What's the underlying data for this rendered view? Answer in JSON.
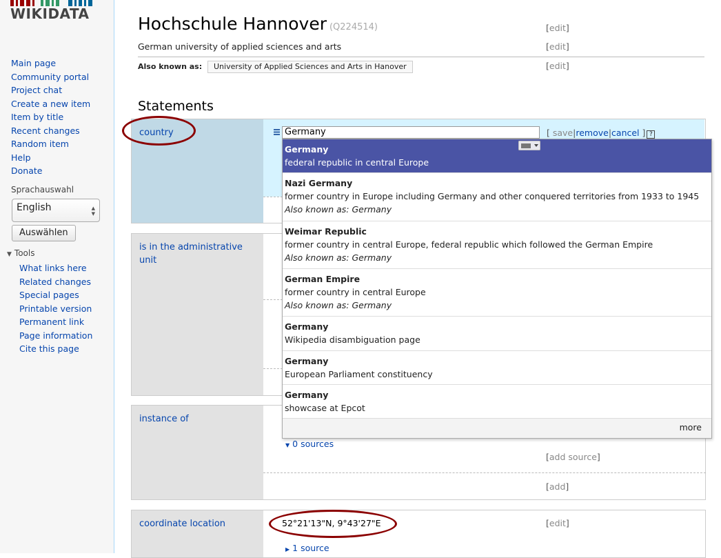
{
  "site": {
    "logo_text": "WIKIDATA"
  },
  "sidebar": {
    "nav": [
      {
        "label": "Main page"
      },
      {
        "label": "Community portal"
      },
      {
        "label": "Project chat"
      },
      {
        "label": "Create a new item"
      },
      {
        "label": "Item by title"
      },
      {
        "label": "Recent changes"
      },
      {
        "label": "Random item"
      },
      {
        "label": "Help"
      },
      {
        "label": "Donate"
      }
    ],
    "language": {
      "heading": "Sprachauswahl",
      "selected": "English",
      "button": "Auswählen"
    },
    "tools": {
      "heading": "Tools",
      "items": [
        {
          "label": "What links here"
        },
        {
          "label": "Related changes"
        },
        {
          "label": "Special pages"
        },
        {
          "label": "Printable version"
        },
        {
          "label": "Permanent link"
        },
        {
          "label": "Page information"
        },
        {
          "label": "Cite this page"
        }
      ]
    }
  },
  "item": {
    "title": "Hochschule Hannover",
    "qid": "(Q224514)",
    "description": "German university of applied sciences and arts",
    "aka_label": "Also known as:",
    "aliases": [
      "University of Applied Sciences and Arts in Hanover"
    ],
    "edit_label": "edit"
  },
  "statements": {
    "heading": "Statements",
    "groups": [
      {
        "property": "country"
      },
      {
        "property": "is in the administrative unit"
      },
      {
        "property": "instance of",
        "sources_label": "0 sources",
        "add_source_label": "add source",
        "add_label": "add"
      },
      {
        "property": "coordinate location",
        "value": "52°21'13\"N, 9°43'27\"E",
        "sources_label": "1 source",
        "edit_label": "edit"
      }
    ]
  },
  "editor": {
    "input_value": "Germany",
    "save_label": "save",
    "remove_label": "remove",
    "cancel_label": "cancel",
    "help_label": "?"
  },
  "suggestions": {
    "items": [
      {
        "label": "Germany",
        "description": "federal republic in central Europe",
        "aka": ""
      },
      {
        "label": "Nazi Germany",
        "description": "former country in Europe including Germany and other conquered territories from 1933 to 1945",
        "aka": "Also known as: Germany"
      },
      {
        "label": "Weimar Republic",
        "description": "former country in central Europe, federal republic which followed the German Empire",
        "aka": "Also known as: Germany"
      },
      {
        "label": "German Empire",
        "description": "former country in central Europe",
        "aka": "Also known as: Germany"
      },
      {
        "label": "Germany",
        "description": "Wikipedia disambiguation page",
        "aka": ""
      },
      {
        "label": "Germany",
        "description": "European Parliament constituency",
        "aka": ""
      },
      {
        "label": "Germany",
        "description": "showcase at Epcot",
        "aka": ""
      }
    ],
    "more_label": "more"
  },
  "colors": {
    "link": "#0645ad",
    "selected_suggestion": "#4a54a5",
    "editing_background": "#d6f3ff",
    "annotation": "#8b0000"
  }
}
